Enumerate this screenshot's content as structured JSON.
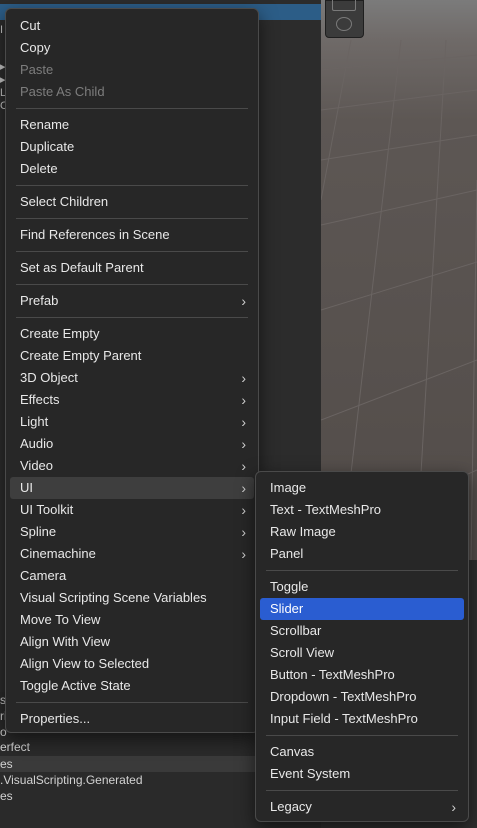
{
  "hierarchy": {
    "left_glyphs": [
      "I",
      "▸",
      "▸",
      "L",
      "C"
    ],
    "bottom_rows": [
      "erfect",
      "es",
      ".VisualScripting.Generated",
      "es"
    ],
    "side_glyphs": [
      "s",
      "ri",
      "o"
    ]
  },
  "main_menu": {
    "items": [
      {
        "label": "Cut"
      },
      {
        "label": "Copy"
      },
      {
        "label": "Paste",
        "disabled": true
      },
      {
        "label": "Paste As Child",
        "disabled": true
      },
      {
        "label": "Rename"
      },
      {
        "label": "Duplicate"
      },
      {
        "label": "Delete"
      },
      {
        "label": "Select Children"
      },
      {
        "label": "Find References in Scene"
      },
      {
        "label": "Set as Default Parent"
      },
      {
        "label": "Prefab",
        "submenu": true
      },
      {
        "label": "Create Empty"
      },
      {
        "label": "Create Empty Parent"
      },
      {
        "label": "3D Object",
        "submenu": true
      },
      {
        "label": "Effects",
        "submenu": true
      },
      {
        "label": "Light",
        "submenu": true
      },
      {
        "label": "Audio",
        "submenu": true
      },
      {
        "label": "Video",
        "submenu": true
      },
      {
        "label": "UI",
        "submenu": true,
        "active": true
      },
      {
        "label": "UI Toolkit",
        "submenu": true
      },
      {
        "label": "Spline",
        "submenu": true
      },
      {
        "label": "Cinemachine",
        "submenu": true
      },
      {
        "label": "Camera"
      },
      {
        "label": "Visual Scripting Scene Variables"
      },
      {
        "label": "Move To View"
      },
      {
        "label": "Align With View"
      },
      {
        "label": "Align View to Selected"
      },
      {
        "label": "Toggle Active State"
      },
      {
        "label": "Properties..."
      }
    ]
  },
  "ui_submenu": {
    "items": [
      {
        "label": "Image"
      },
      {
        "label": "Text - TextMeshPro"
      },
      {
        "label": "Raw Image"
      },
      {
        "label": "Panel"
      },
      {
        "label": "Toggle"
      },
      {
        "label": "Slider",
        "selected": true
      },
      {
        "label": "Scrollbar"
      },
      {
        "label": "Scroll View"
      },
      {
        "label": "Button - TextMeshPro"
      },
      {
        "label": "Dropdown - TextMeshPro"
      },
      {
        "label": "Input Field - TextMeshPro"
      },
      {
        "label": "Canvas"
      },
      {
        "label": "Event System"
      },
      {
        "label": "Legacy",
        "submenu": true
      }
    ]
  },
  "icons": {
    "submenu_arrow": "chevron-right-icon",
    "rect_tool": "rect-tool-icon",
    "transform_tool": "transform-tool-icon"
  },
  "colors": {
    "menu_bg": "#272727",
    "selection": "#2a5dd1",
    "hierarchy_selection": "#2c5d87"
  }
}
